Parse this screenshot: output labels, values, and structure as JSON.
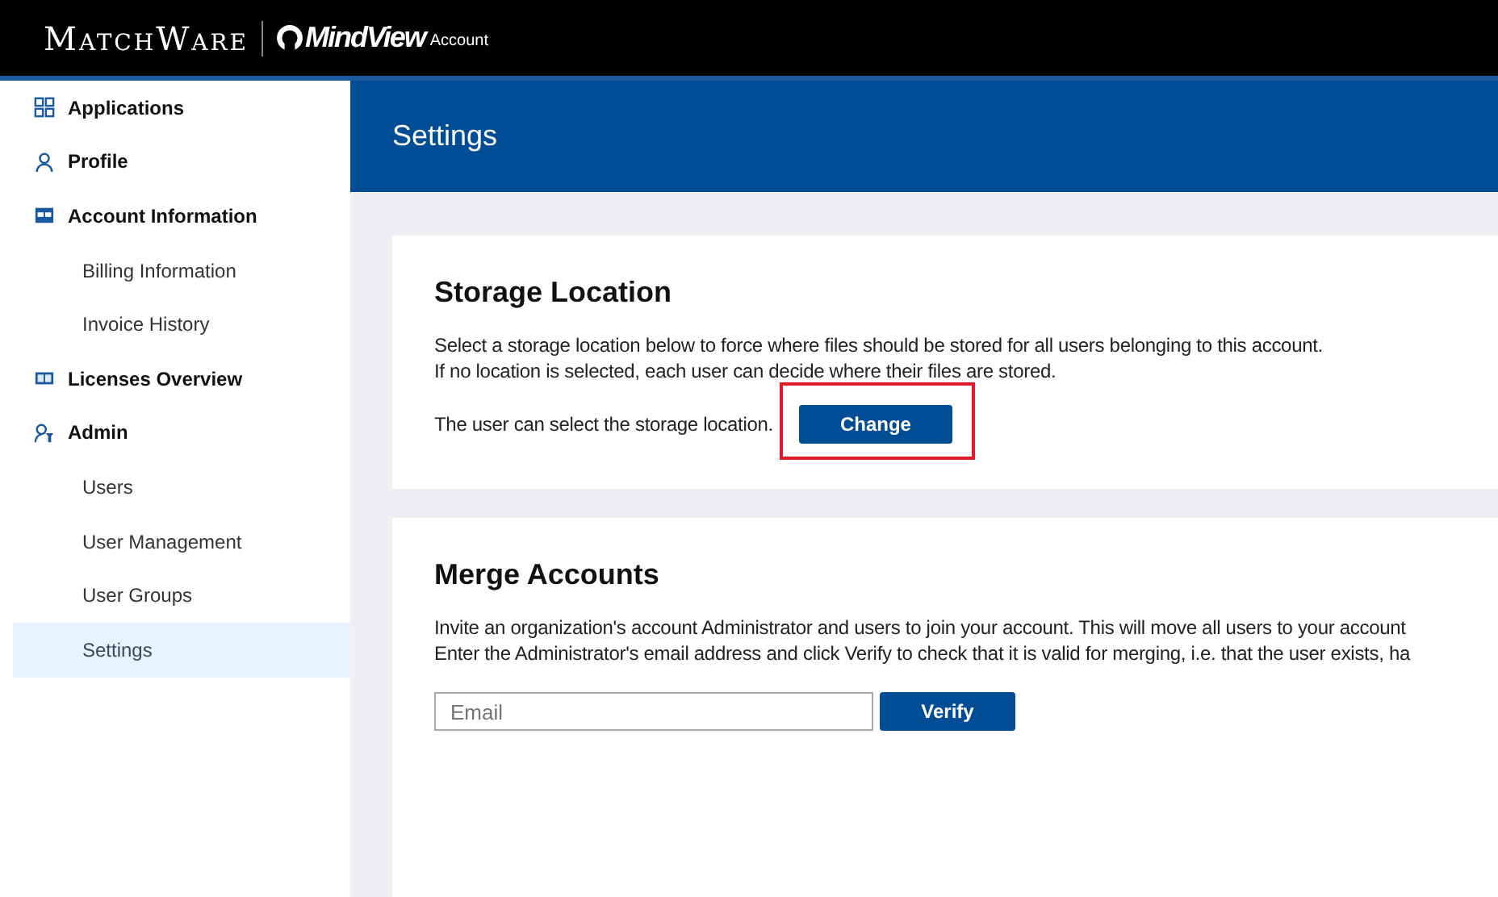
{
  "header": {
    "brand": "MatchWare",
    "product": "MindView",
    "product_suffix": "Account"
  },
  "sidebar": {
    "items": [
      {
        "label": "Applications",
        "kind": "grid",
        "selected": false
      },
      {
        "label": "Profile",
        "kind": "person",
        "selected": false
      },
      {
        "label": "Account Information",
        "kind": "card",
        "selected": false,
        "children": [
          {
            "label": "Billing Information",
            "selected": false
          },
          {
            "label": "Invoice History",
            "selected": false
          }
        ]
      },
      {
        "label": "Licenses Overview",
        "kind": "license",
        "selected": false
      },
      {
        "label": "Admin",
        "kind": "admin",
        "selected": false,
        "children": [
          {
            "label": "Users",
            "selected": false
          },
          {
            "label": "User Management",
            "selected": false
          },
          {
            "label": "User Groups",
            "selected": false
          },
          {
            "label": "Settings",
            "selected": true
          }
        ]
      }
    ]
  },
  "page_title": "Settings",
  "storage": {
    "title": "Storage Location",
    "description": [
      "Select a storage location below to force where files should be stored for all users belonging to this account.",
      "If no location is selected, each user can decide where their files are stored."
    ],
    "status": "The user can select the storage location.",
    "button": "Change",
    "highlighted": true
  },
  "merge": {
    "title": "Merge Accounts",
    "description": [
      "Invite an organization's account Administrator and users to join your account. This will move all users to your account",
      "Enter the Administrator's email address and click Verify to check that it is valid for merging, i.e. that the user exists, ha"
    ],
    "email": {
      "placeholder": "Email"
    },
    "button": "Verify"
  }
}
